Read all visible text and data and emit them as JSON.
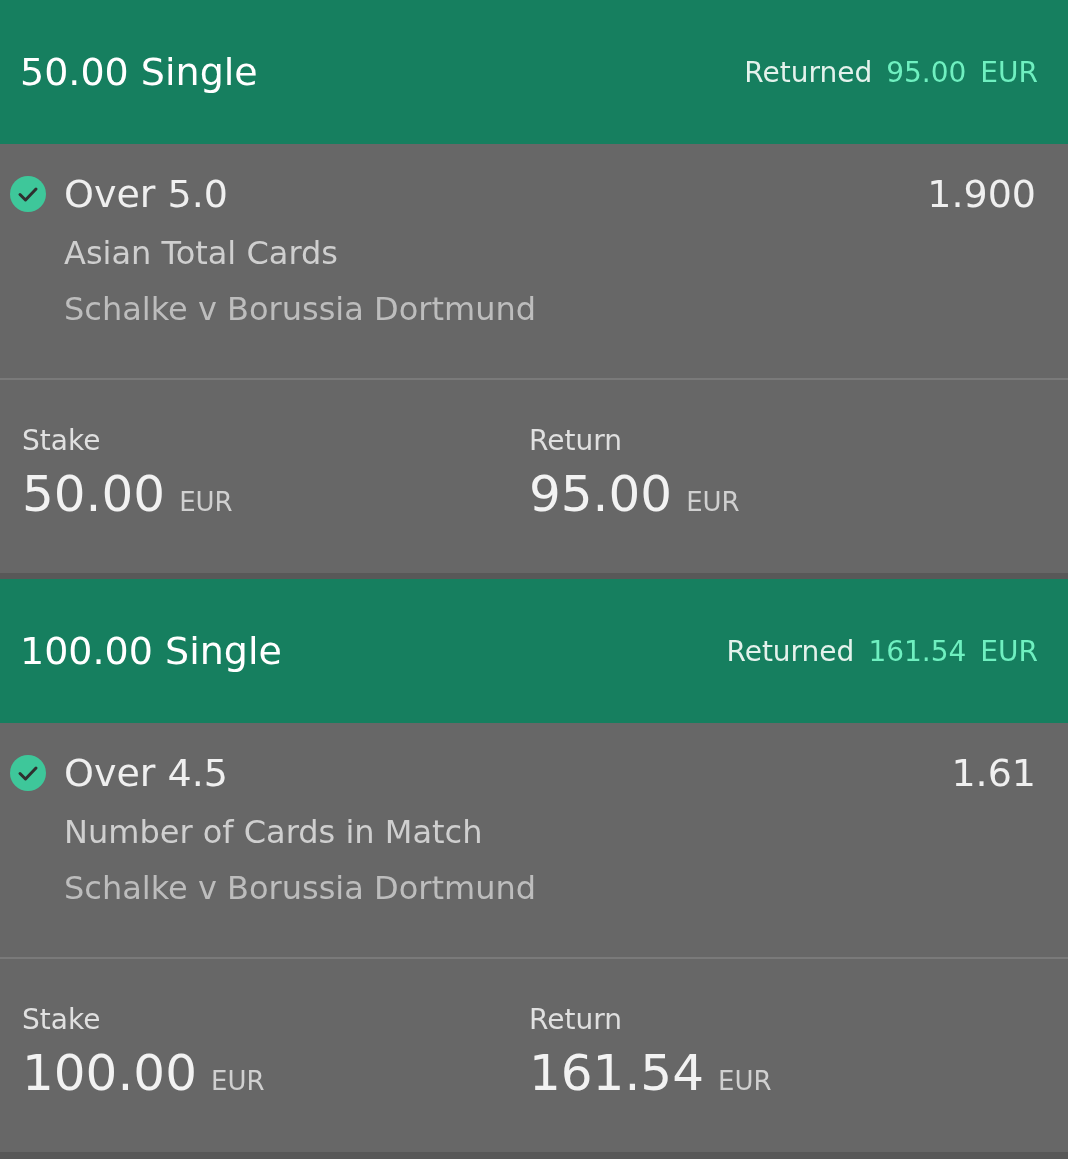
{
  "bets": [
    {
      "title": "50.00 Single",
      "returned_label": "Returned",
      "returned_amount": "95.00",
      "returned_currency": "EUR",
      "selection": {
        "name": "Over 5.0",
        "won": true,
        "market": "Asian Total Cards",
        "event": "Schalke v Borussia Dortmund",
        "odds": "1.900"
      },
      "stake_label": "Stake",
      "stake": "50.00",
      "stake_currency": "EUR",
      "return_label": "Return",
      "return": "95.00",
      "return_currency": "EUR"
    },
    {
      "title": "100.00 Single",
      "returned_label": "Returned",
      "returned_amount": "161.54",
      "returned_currency": "EUR",
      "selection": {
        "name": "Over 4.5",
        "won": true,
        "market": "Number of Cards in Match",
        "event": "Schalke v Borussia Dortmund",
        "odds": "1.61"
      },
      "stake_label": "Stake",
      "stake": "100.00",
      "stake_currency": "EUR",
      "return_label": "Return",
      "return": "161.54",
      "return_currency": "EUR"
    }
  ]
}
